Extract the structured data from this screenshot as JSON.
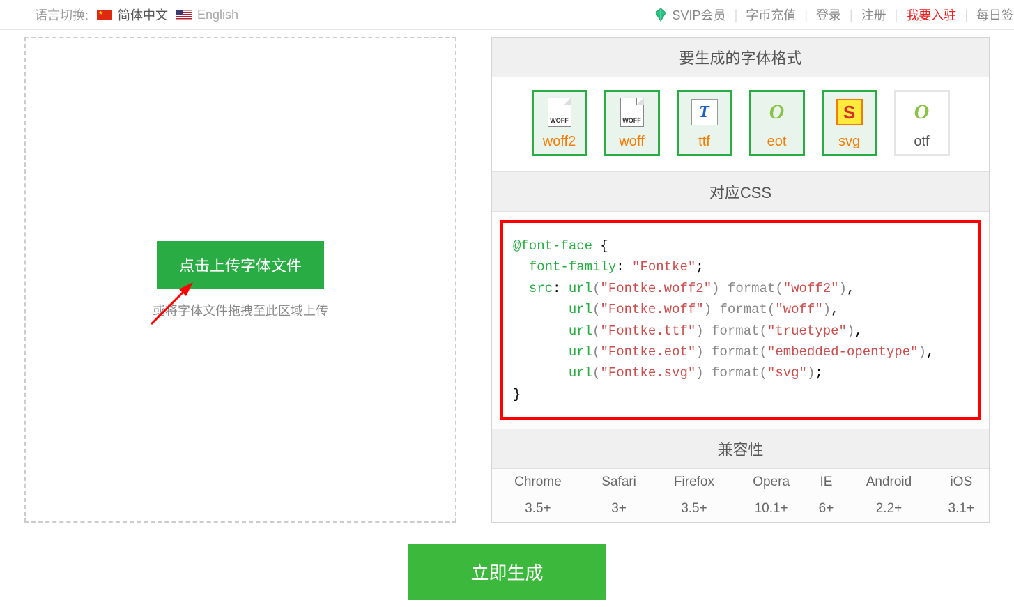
{
  "topbar": {
    "lang_label": "语言切换:",
    "lang_cn": "简体中文",
    "lang_en": "English",
    "nav": {
      "svip": "SVIP会员",
      "recharge": "字币充值",
      "login": "登录",
      "register": "注册",
      "join": "我要入驻",
      "daily": "每日签"
    }
  },
  "upload": {
    "button": "点击上传字体文件",
    "hint": "或将字体文件拖拽至此区域上传"
  },
  "panel": {
    "formats_title": "要生成的字体格式",
    "css_title": "对应CSS",
    "compat_title": "兼容性"
  },
  "formats": [
    {
      "label": "woff2",
      "icon_text": "WOFF",
      "selected": true,
      "type": "file"
    },
    {
      "label": "woff",
      "icon_text": "WOFF",
      "selected": true,
      "type": "file"
    },
    {
      "label": "ttf",
      "icon_text": "T",
      "selected": true,
      "type": "ttf"
    },
    {
      "label": "eot",
      "icon_text": "O",
      "selected": true,
      "type": "eot"
    },
    {
      "label": "svg",
      "icon_text": "S",
      "selected": true,
      "type": "svg"
    },
    {
      "label": "otf",
      "icon_text": "O",
      "selected": false,
      "type": "eot"
    }
  ],
  "css_code": {
    "at_rule": "@font-face",
    "font_family_prop": "font-family",
    "font_family_val": "\"Fontke\"",
    "src_prop": "src",
    "lines": [
      {
        "file": "\"Fontke.woff2\"",
        "fmt": "\"woff2\""
      },
      {
        "file": "\"Fontke.woff\"",
        "fmt": "\"woff\""
      },
      {
        "file": "\"Fontke.ttf\"",
        "fmt": "\"truetype\""
      },
      {
        "file": "\"Fontke.eot\"",
        "fmt": "\"embedded-opentype\""
      },
      {
        "file": "\"Fontke.svg\"",
        "fmt": "\"svg\""
      }
    ]
  },
  "compat": {
    "browsers": [
      "Chrome",
      "Safari",
      "Firefox",
      "Opera",
      "IE",
      "Android",
      "iOS"
    ],
    "versions": [
      "3.5+",
      "3+",
      "3.5+",
      "10.1+",
      "6+",
      "2.2+",
      "3.1+"
    ]
  },
  "generate_btn": "立即生成"
}
